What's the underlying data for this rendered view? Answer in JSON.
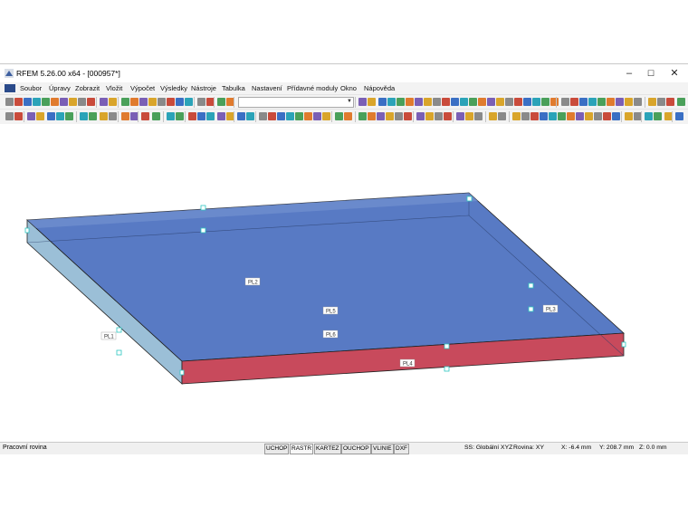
{
  "window": {
    "title": "RFEM 5.26.00 x64 - [000957*]",
    "minimize_glyph": "–",
    "maximize_glyph": "☐",
    "close_glyph": "✕"
  },
  "menu": [
    "Soubor",
    "Úpravy",
    "Zobrazit",
    "Vložit",
    "Výpočet",
    "Výsledky",
    "Nástroje",
    "Tabulka",
    "Nastavení",
    "Přídavné moduly",
    "Okno",
    "Nápověda"
  ],
  "model": {
    "labels": {
      "top_front": "PL2",
      "center": "PL5",
      "center2": "PL6",
      "left": "PL1",
      "right": "PL3",
      "front": "PL4"
    },
    "colors": {
      "top": "#4a6fbf",
      "front": "#c84a5c",
      "left": "#8ab4d0",
      "edge": "#222222",
      "node": "#2cc5c0"
    }
  },
  "status": {
    "left": "Pracovní rovina",
    "buttons": [
      "UCHOP",
      "RASTR",
      "KARTEZ",
      "OUCHOP",
      "VLINIE",
      "DXF"
    ],
    "coord_system": "SS: Globální XYZ",
    "plane": "Rovina: XY",
    "x": "X:  -6.4 mm",
    "y": "Y:  208.7 mm",
    "z": "Z:  0.0 mm"
  }
}
